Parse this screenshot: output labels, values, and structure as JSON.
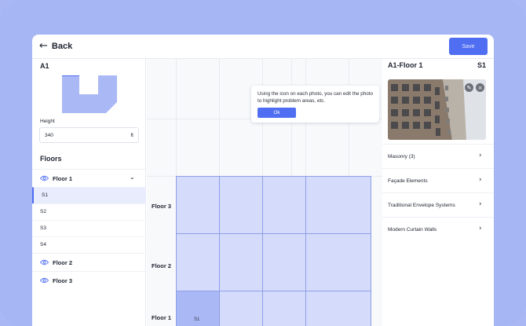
{
  "header": {
    "back_label": "Back",
    "back_icon": "arrow-left-icon",
    "save_label": "Save"
  },
  "building": {
    "name": "A1",
    "height_label": "Height",
    "height_value": "340",
    "height_unit": "ft"
  },
  "floors": {
    "title": "Floors",
    "items": [
      {
        "label": "Floor 1",
        "expanded": true,
        "spaces": [
          "S1",
          "S2",
          "S3",
          "S4"
        ],
        "active_space": "S1"
      },
      {
        "label": "Floor 2"
      },
      {
        "label": "Floor 3"
      }
    ]
  },
  "canvas": {
    "floor_labels": [
      "Floor 3",
      "Floor 2",
      "Floor 1"
    ],
    "cell_label": "S1",
    "tooltip": {
      "text": "Using the icon on each photo, you can edit the photo to highlight problem areas, etc.",
      "ok_label": "Ok"
    }
  },
  "detail": {
    "title": "A1-Floor 1",
    "space": "S1",
    "photo_icons": [
      "edit-icon",
      "close-icon"
    ],
    "categories": [
      {
        "label": "Masonry (3)"
      },
      {
        "label": "Façade Elements"
      },
      {
        "label": "Traditional Envelope Systems"
      },
      {
        "label": "Modern Curtain Walls"
      }
    ]
  },
  "colors": {
    "accent": "#4f6ef2",
    "background": "#a9b8f5",
    "cell_fill": "#d5dcfb",
    "cell_selected": "#aab8f5"
  }
}
